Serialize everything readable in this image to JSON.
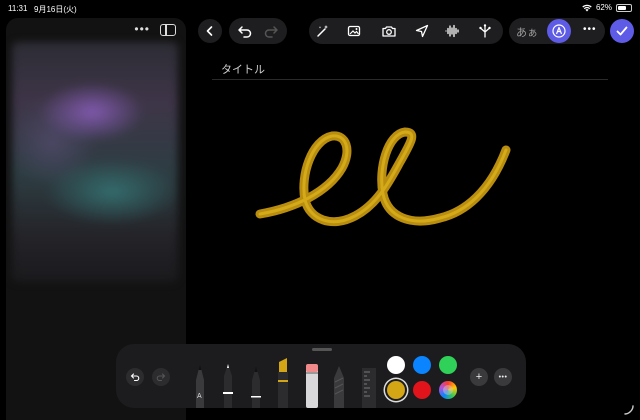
{
  "status_bar": {
    "time": "11:31",
    "date": "9月16日(火)",
    "battery_percent": "62%",
    "battery_level": 0.62
  },
  "sidebar": {
    "more_label": "•••"
  },
  "note": {
    "title_placeholder": "タイトル"
  },
  "toolbar": {
    "text_style_label": "あぁ",
    "more_label": "•••",
    "icons": [
      "back-icon",
      "undo-icon",
      "redo-icon",
      "magic-wand-icon",
      "photo-icon",
      "camera-icon",
      "location-icon",
      "audio-waveform-icon",
      "share-tree-icon",
      "pencil-circle-icon",
      "done-checkmark-icon"
    ]
  },
  "tool_palette": {
    "tools": [
      "pencil-a-tool",
      "fineliner-tool",
      "pen-tool",
      "marker-tool",
      "eraser-tool",
      "crayon-tool",
      "ruler-tool"
    ],
    "colors": [
      "#ffffff",
      "#0a84ff",
      "#30d158",
      "#d4a514",
      "#e0141a"
    ],
    "selected_color": "#d4a514",
    "add_label": "+",
    "more_label": "•••"
  },
  "colors": {
    "accent": "#5e5ce6",
    "ink": "#c99a12"
  }
}
